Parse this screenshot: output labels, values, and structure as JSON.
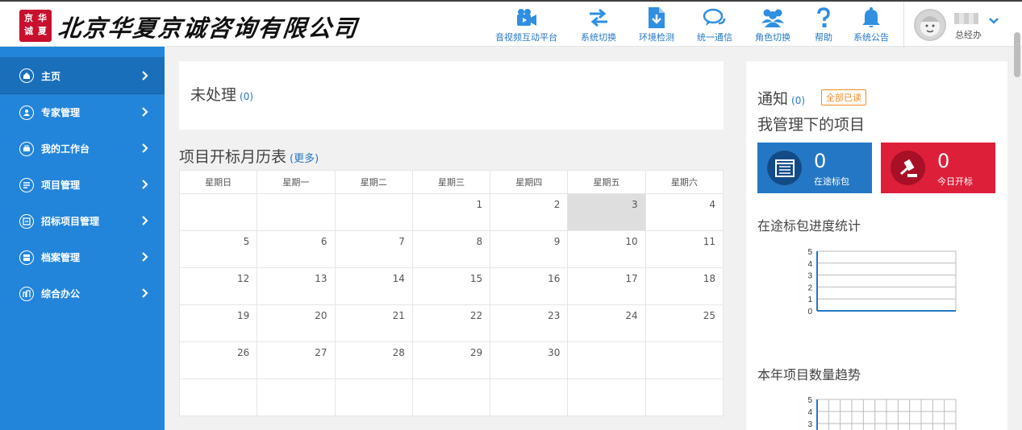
{
  "header": {
    "logo_seal": "京华诚夏",
    "company_name": "北京华夏京诚咨询有限公司",
    "nav": [
      {
        "label": "音视频互动平台",
        "icon": "video-camera-icon"
      },
      {
        "label": "系统切换",
        "icon": "swap-arrows-icon"
      },
      {
        "label": "环境检测",
        "icon": "document-download-icon"
      },
      {
        "label": "统一通信",
        "icon": "chat-bubbles-icon"
      },
      {
        "label": "角色切换",
        "icon": "users-icon"
      },
      {
        "label": "帮助",
        "icon": "question-icon"
      },
      {
        "label": "系统公告",
        "icon": "bell-icon"
      }
    ],
    "user": {
      "role": "总经办"
    }
  },
  "sidebar": {
    "items": [
      {
        "label": "主页",
        "icon": "home-icon",
        "active": true
      },
      {
        "label": "专家管理",
        "icon": "expert-icon"
      },
      {
        "label": "我的工作台",
        "icon": "workbench-icon"
      },
      {
        "label": "项目管理",
        "icon": "project-icon"
      },
      {
        "label": "招标项目管理",
        "icon": "bid-project-icon"
      },
      {
        "label": "档案管理",
        "icon": "archive-icon"
      },
      {
        "label": "综合办公",
        "icon": "office-icon"
      }
    ]
  },
  "unprocessed": {
    "title": "未处理",
    "count": "(0)"
  },
  "calendar": {
    "title": "项目开标月历表",
    "more": "(更多)",
    "weekdays": [
      "星期日",
      "星期一",
      "星期二",
      "星期三",
      "星期四",
      "星期五",
      "星期六"
    ],
    "weeks": [
      [
        "",
        "",
        "",
        "1",
        "2",
        "3",
        "4"
      ],
      [
        "5",
        "6",
        "7",
        "8",
        "9",
        "10",
        "11"
      ],
      [
        "12",
        "13",
        "14",
        "15",
        "16",
        "17",
        "18"
      ],
      [
        "19",
        "20",
        "21",
        "22",
        "23",
        "24",
        "25"
      ],
      [
        "26",
        "27",
        "28",
        "29",
        "30",
        "",
        ""
      ],
      [
        "",
        "",
        "",
        "",
        "",
        "",
        ""
      ]
    ],
    "today": "3"
  },
  "right": {
    "notice_title": "通知",
    "notice_count": "(0)",
    "mark_all_read": "全部已读",
    "my_projects_title": "我管理下的项目",
    "cards": [
      {
        "value": "0",
        "label": "在途标包",
        "color": "#2477c4",
        "icon": "package-list-icon"
      },
      {
        "value": "0",
        "label": "今日开标",
        "color": "#dd1f3a",
        "icon": "gavel-icon"
      }
    ],
    "progress_title": "在途标包进度统计",
    "trend_title": "本年项目数量趋势"
  },
  "chart_data": [
    {
      "type": "bar",
      "title": "在途标包进度统计",
      "categories": [],
      "values": [],
      "ylim": [
        0,
        5
      ],
      "yticks": [
        "0",
        "1",
        "2",
        "3",
        "4",
        "5"
      ],
      "grid": true
    },
    {
      "type": "line",
      "title": "本年项目数量趋势",
      "x": [],
      "values": [],
      "ylim": [
        0,
        5
      ],
      "yticks_visible": [
        "5",
        "4",
        "3"
      ],
      "grid": true
    }
  ]
}
